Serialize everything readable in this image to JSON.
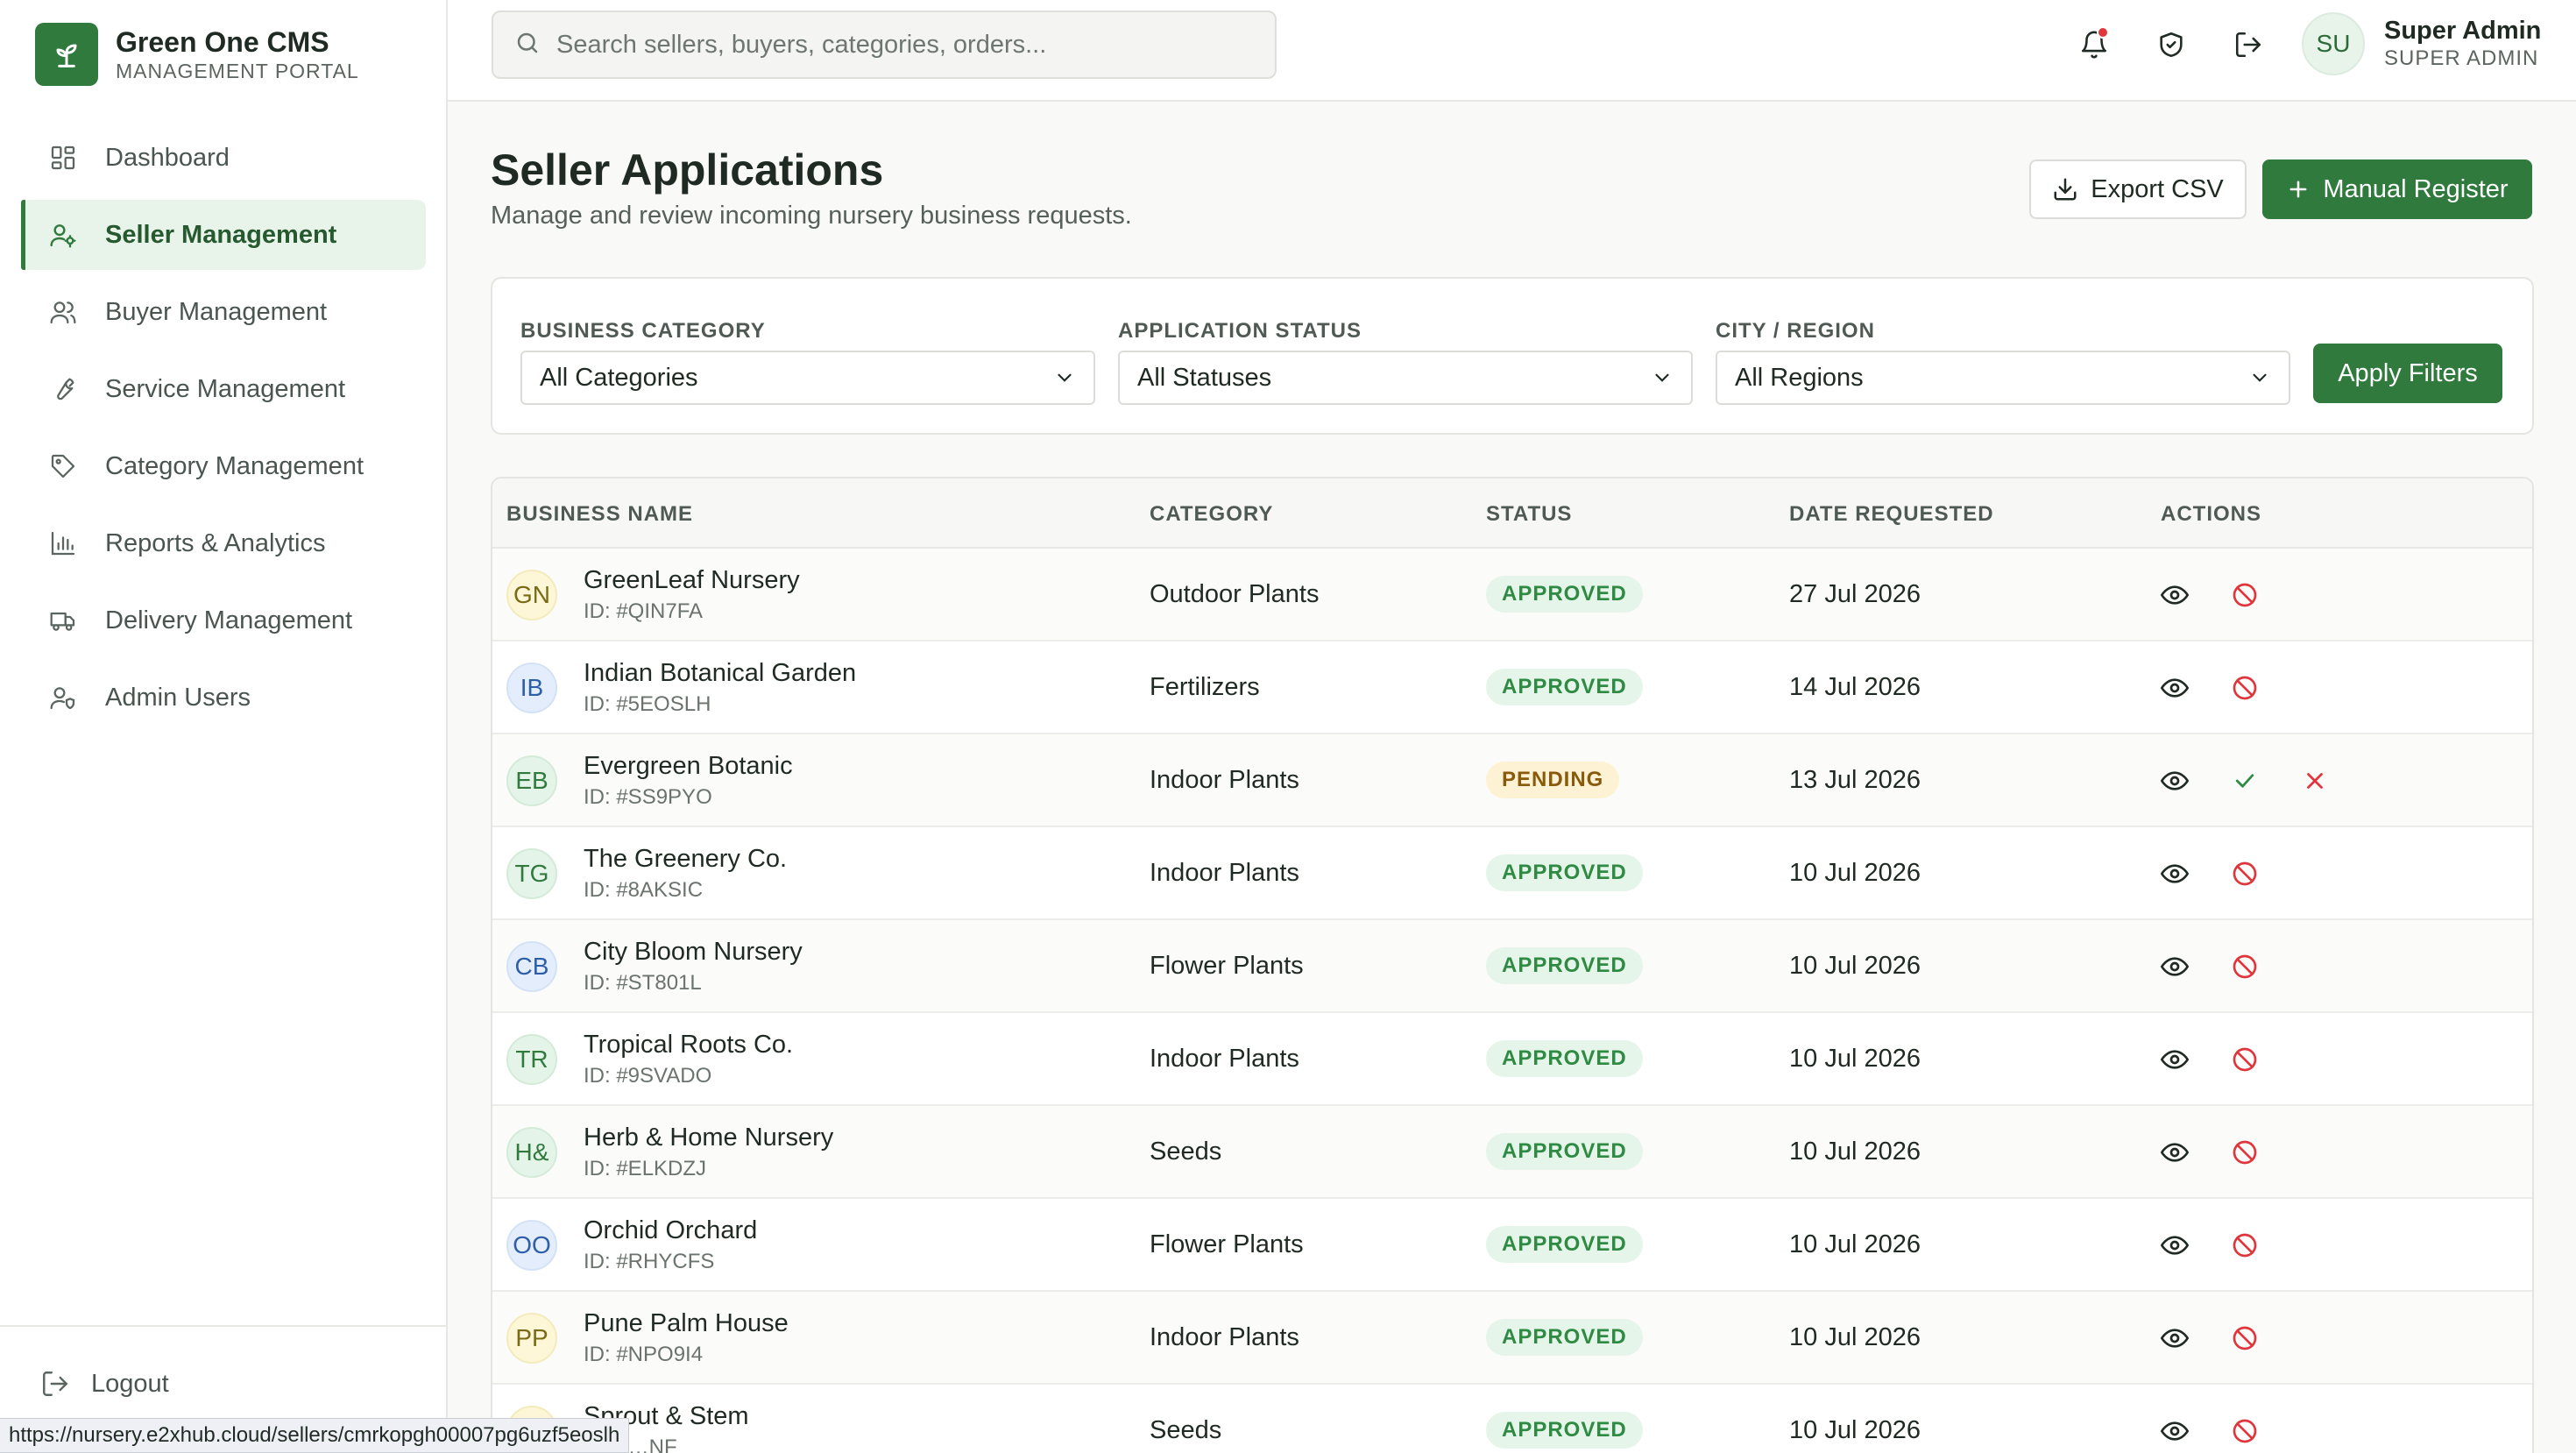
{
  "brand": {
    "title": "Green One CMS",
    "subtitle": "MANAGEMENT PORTAL"
  },
  "nav": {
    "items": [
      {
        "label": "Dashboard"
      },
      {
        "label": "Seller Management"
      },
      {
        "label": "Buyer Management"
      },
      {
        "label": "Service Management"
      },
      {
        "label": "Category Management"
      },
      {
        "label": "Reports & Analytics"
      },
      {
        "label": "Delivery Management"
      },
      {
        "label": "Admin Users"
      }
    ],
    "active": "Seller Management",
    "logout": "Logout"
  },
  "status_bar_url": "https://nursery.e2xhub.cloud/sellers/cmrkopgh00007pg6uzf5eoslh",
  "topbar": {
    "search_placeholder": "Search sellers, buyers, categories, orders...",
    "user": {
      "initials": "SU",
      "name": "Super Admin",
      "role": "SUPER ADMIN"
    }
  },
  "page": {
    "title": "Seller Applications",
    "subtitle": "Manage and review incoming nursery business requests.",
    "export_label": "Export CSV",
    "register_label": "Manual Register"
  },
  "filters": {
    "category": {
      "label": "BUSINESS CATEGORY",
      "value": "All Categories"
    },
    "status": {
      "label": "APPLICATION STATUS",
      "value": "All Statuses"
    },
    "region": {
      "label": "CITY / REGION",
      "value": "All Regions"
    },
    "apply_label": "Apply Filters"
  },
  "table": {
    "headers": {
      "name": "BUSINESS NAME",
      "category": "CATEGORY",
      "status": "STATUS",
      "date": "DATE REQUESTED",
      "actions": "ACTIONS"
    },
    "rows": [
      {
        "initials": "GN",
        "color": "yellow",
        "name": "GreenLeaf Nursery",
        "id": "ID: #QIN7FA",
        "category": "Outdoor Plants",
        "status": "APPROVED",
        "date": "27 Jul 2026"
      },
      {
        "initials": "IB",
        "color": "blue",
        "name": "Indian Botanical Garden",
        "id": "ID: #5EOSLH",
        "category": "Fertilizers",
        "status": "APPROVED",
        "date": "14 Jul 2026"
      },
      {
        "initials": "EB",
        "color": "green",
        "name": "Evergreen Botanic",
        "id": "ID: #SS9PYO",
        "category": "Indoor Plants",
        "status": "PENDING",
        "date": "13 Jul 2026"
      },
      {
        "initials": "TG",
        "color": "green",
        "name": "The Greenery Co.",
        "id": "ID: #8AKSIC",
        "category": "Indoor Plants",
        "status": "APPROVED",
        "date": "10 Jul 2026"
      },
      {
        "initials": "CB",
        "color": "blue",
        "name": "City Bloom Nursery",
        "id": "ID: #ST801L",
        "category": "Flower Plants",
        "status": "APPROVED",
        "date": "10 Jul 2026"
      },
      {
        "initials": "TR",
        "color": "green",
        "name": "Tropical Roots Co.",
        "id": "ID: #9SVADO",
        "category": "Indoor Plants",
        "status": "APPROVED",
        "date": "10 Jul 2026"
      },
      {
        "initials": "H&",
        "color": "green",
        "name": "Herb & Home Nursery",
        "id": "ID: #ELKDZJ",
        "category": "Seeds",
        "status": "APPROVED",
        "date": "10 Jul 2026"
      },
      {
        "initials": "OO",
        "color": "blue",
        "name": "Orchid Orchard",
        "id": "ID: #RHYCFS",
        "category": "Flower Plants",
        "status": "APPROVED",
        "date": "10 Jul 2026"
      },
      {
        "initials": "PP",
        "color": "yellow",
        "name": "Pune Palm House",
        "id": "ID: #NPO9I4",
        "category": "Indoor Plants",
        "status": "APPROVED",
        "date": "10 Jul 2026"
      },
      {
        "initials": "SS",
        "color": "yellow",
        "name": "Sprout & Stem",
        "id": "ID: #…NF",
        "category": "Seeds",
        "status": "APPROVED",
        "date": "10 Jul 2026"
      }
    ]
  },
  "colors": {
    "primary": "#2f7a3c",
    "approved": "#2f8a43",
    "pending": "#8a5a0c",
    "block": "#e0353b"
  }
}
